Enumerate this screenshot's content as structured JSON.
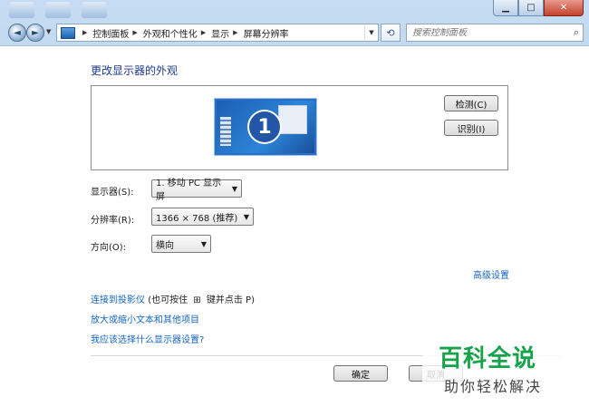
{
  "window": {
    "caption_buttons": {
      "minimize": "▁",
      "maximize": "□",
      "close": "✕"
    }
  },
  "nav": {
    "back_icon": "◄",
    "forward_icon": "►",
    "breadcrumbs": [
      "控制面板",
      "外观和个性化",
      "显示",
      "屏幕分辨率"
    ],
    "refresh_icon": "⟲",
    "search_placeholder": "搜索控制面板",
    "search_icon": "⌕"
  },
  "main": {
    "heading": "更改显示器的外观",
    "monitor_number": "1",
    "detect_label": "检测(C)",
    "identify_label": "识别(I)",
    "fields": {
      "display_label": "显示器(S):",
      "display_value": "1. 移动 PC 显示屏",
      "resolution_label": "分辨率(R):",
      "resolution_value": "1366 × 768 (推荐)",
      "orientation_label": "方向(O):",
      "orientation_value": "横向"
    },
    "advanced_link": "高级设置",
    "projector_link": "连接到投影仪",
    "projector_hint_prefix": "(也可按住",
    "projector_hint_suffix": "键并点击 P)",
    "zoom_link": "放大或缩小文本和其他项目",
    "which_link": "我应该选择什么显示器设置?",
    "ok_label": "确定",
    "cancel_label": "取消"
  },
  "watermark": {
    "title": "百科全说",
    "subtitle": "助你轻松解决"
  }
}
